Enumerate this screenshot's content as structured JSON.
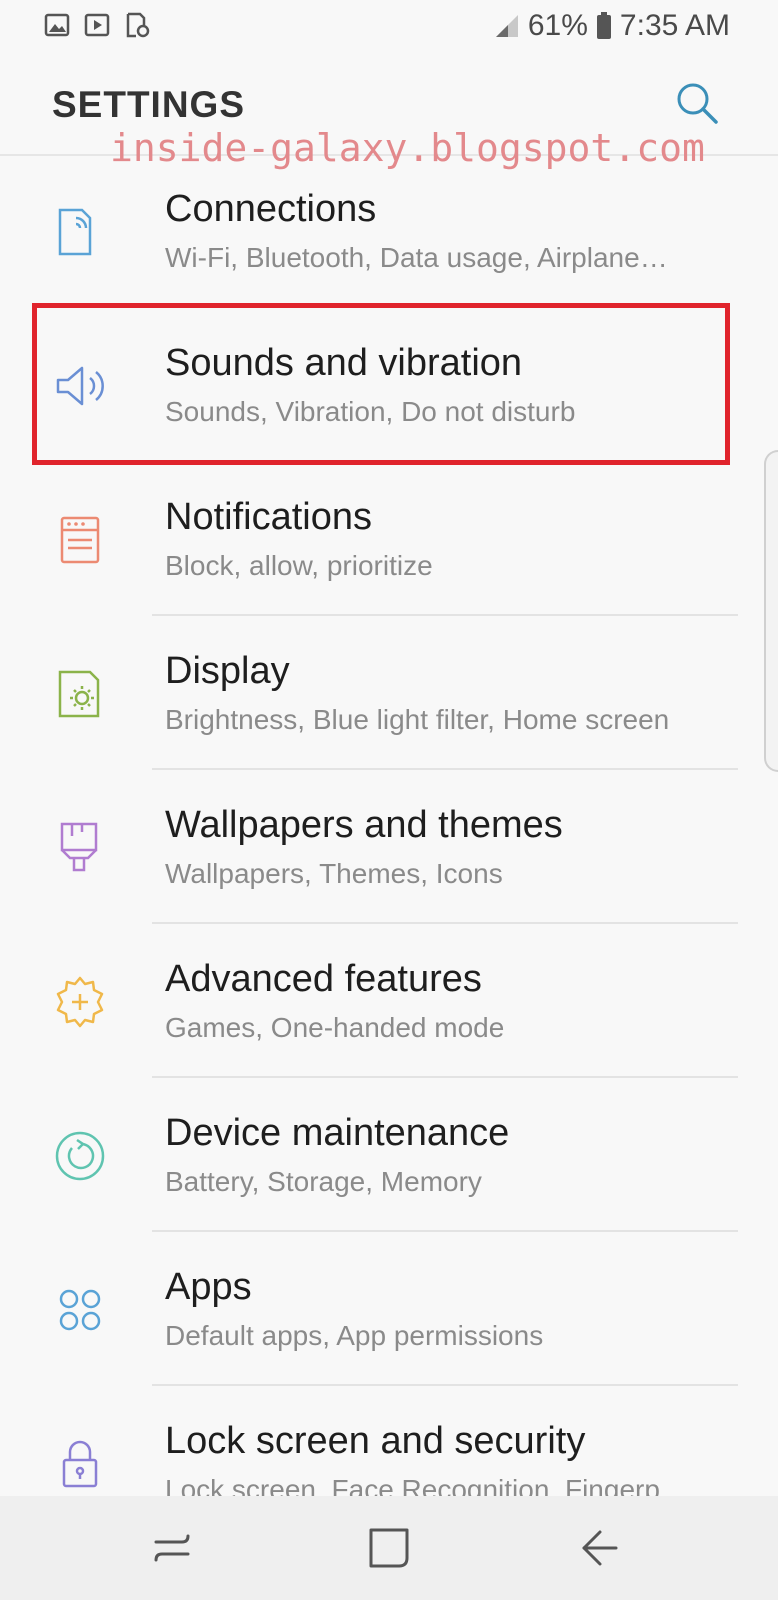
{
  "status_bar": {
    "battery": "61%",
    "time": "7:35 AM"
  },
  "header": {
    "title": "SETTINGS"
  },
  "watermark": "inside-galaxy.blogspot.com",
  "items": [
    {
      "label": "Connections",
      "sub": "Wi-Fi, Bluetooth, Data usage, Airplane…",
      "icon": "connections-icon",
      "color": "#5aa3d6"
    },
    {
      "label": "Sounds and vibration",
      "sub": "Sounds, Vibration, Do not disturb",
      "icon": "speaker-icon",
      "color": "#6a8fd4"
    },
    {
      "label": "Notifications",
      "sub": "Block, allow, prioritize",
      "icon": "notifications-icon",
      "color": "#ec8a72"
    },
    {
      "label": "Display",
      "sub": "Brightness, Blue light filter, Home screen",
      "icon": "display-icon",
      "color": "#8bb34a"
    },
    {
      "label": "Wallpapers and themes",
      "sub": "Wallpapers, Themes, Icons",
      "icon": "paintbrush-icon",
      "color": "#b07cd0"
    },
    {
      "label": "Advanced features",
      "sub": "Games, One-handed mode",
      "icon": "gear-plus-icon",
      "color": "#f0b84a"
    },
    {
      "label": "Device maintenance",
      "sub": "Battery, Storage, Memory",
      "icon": "maintenance-icon",
      "color": "#5fc4b0"
    },
    {
      "label": "Apps",
      "sub": "Default apps, App permissions",
      "icon": "apps-icon",
      "color": "#5aa3d6"
    },
    {
      "label": "Lock screen and security",
      "sub": "Lock screen, Face Recognition, Fingerp…",
      "icon": "lock-icon",
      "color": "#8a7fd4"
    }
  ],
  "highlighted_item": "Sounds and vibration",
  "highlight_color": "#e0242c"
}
